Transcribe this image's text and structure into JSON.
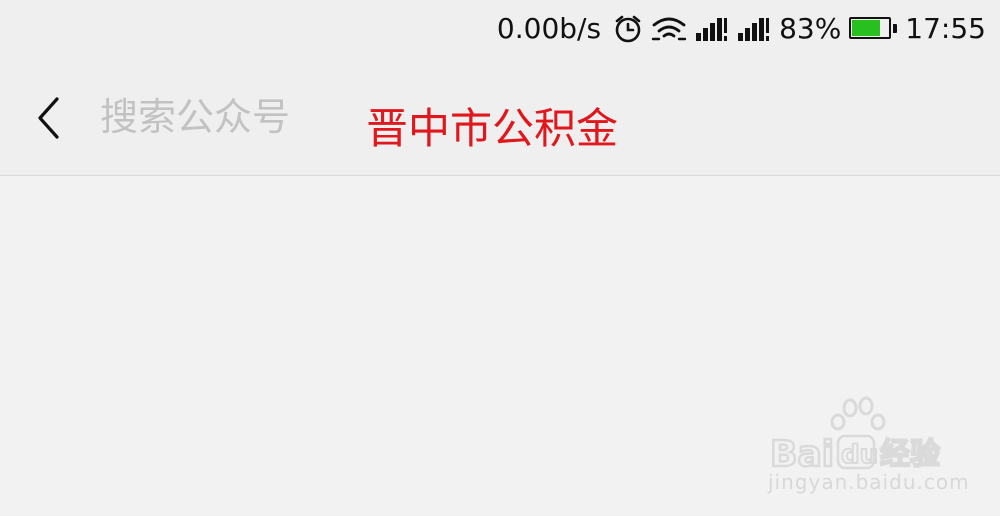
{
  "status_bar": {
    "net_speed": "0.00b/s",
    "battery_percent_text": "83%",
    "battery_level": 0.83,
    "time": "17:55",
    "icons": [
      "alarm-icon",
      "wifi-icon",
      "signal-icon",
      "signal-icon"
    ]
  },
  "header": {
    "search_placeholder": "搜索公众号",
    "search_value": "",
    "hint_text": "晋中市公积金"
  },
  "watermark": {
    "brand": "Baidu经验",
    "url": "jingyan.baidu.com"
  },
  "colors": {
    "hint_red": "#e0171c",
    "battery_green": "#28c01e",
    "background": "#f2f2f2"
  }
}
